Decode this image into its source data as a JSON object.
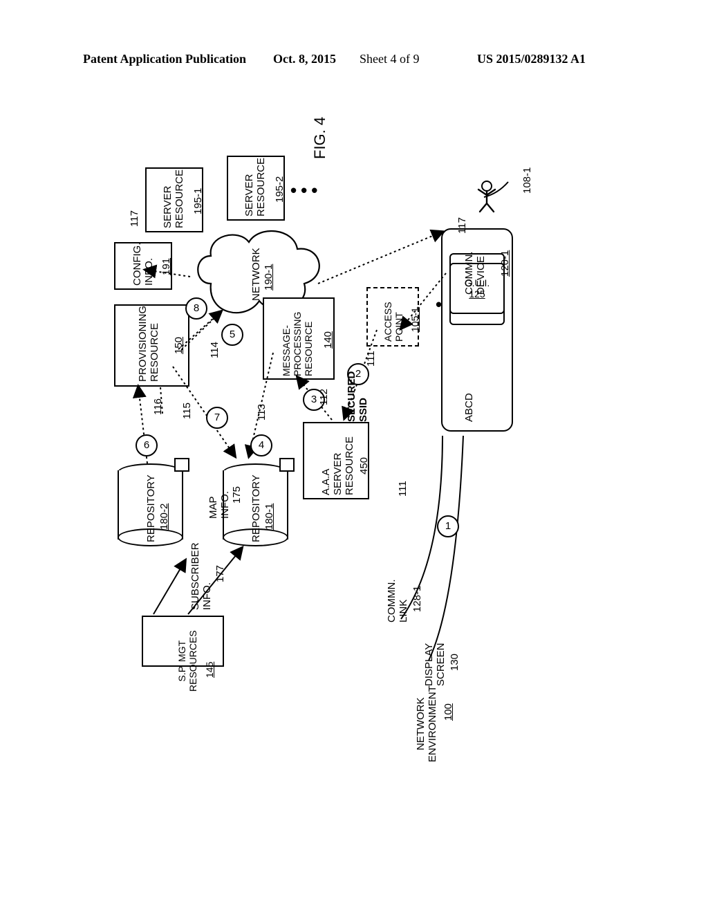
{
  "header": {
    "left": "Patent Application Publication",
    "date": "Oct. 8, 2015",
    "sheet": "Sheet 4 of 9",
    "pubnum": "US 2015/0289132 A1"
  },
  "figure_label": "FIG. 4",
  "labels": {
    "network_env": "NETWORK\nENVIRONMENT",
    "network_env_num": "100",
    "sp_mgt": "S.P. MGT\nRESOURCES",
    "sp_mgt_num": "145",
    "subscriber_info": "SUBSCRIBER\nINFO.",
    "subscriber_info_num": "177",
    "map_info": "MAP\nINFO.",
    "map_info_num": "175",
    "repo1": "REPOSITORY",
    "repo1_num": "180-1",
    "repo2": "REPOSITORY",
    "repo2_num": "180-2",
    "prov": "PROVISIONING\nRESOURCE",
    "prov_num": "150",
    "config": "CONFIG.\nINFO.",
    "config_num": "191",
    "net_cloud": "NETWORK",
    "net_cloud_num": "190-1",
    "srv1": "SERVER\nRESOURCE",
    "srv1_num": "195-1",
    "srv2": "SERVER\nRESOURCE",
    "srv2_num": "195-2",
    "msgproc": "MESSAGE-\nPROCESSING\nRESOURCE",
    "msgproc_num": "140",
    "aaa": "A.A.A\nSERVER\nRESOURCE",
    "aaa_num": "450",
    "ap": "ACCESS\nPOINT",
    "ap_num": "105-1",
    "display_screen": "DISPLAY\nSCREEN",
    "display_screen_num": "130",
    "commn_link": "COMMN.\nLINK",
    "commn_link_num": "128-1",
    "secured_ssid": "SECURED\nSSID",
    "abcd": "ABCD",
    "gui": "G.U.I.",
    "gui_num": "125",
    "commn_device": "COMMN.\nDEVICE",
    "commn_device_num": "120-1",
    "user_num": "108-1",
    "seg_111a": "111",
    "seg_111b": "111",
    "seg_112": "112",
    "seg_113": "113",
    "seg_114": "114",
    "seg_115": "115",
    "seg_116": "116",
    "seg_117a": "117",
    "seg_117b": "117"
  },
  "steps": [
    "1",
    "2",
    "3",
    "4",
    "5",
    "6",
    "7",
    "8"
  ]
}
